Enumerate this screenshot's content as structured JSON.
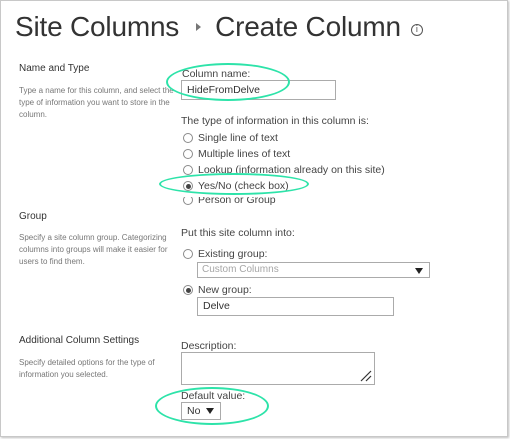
{
  "header": {
    "breadcrumb_parent": "Site Columns",
    "page_title": "Create Column"
  },
  "name_type": {
    "heading": "Name and Type",
    "description": "Type a name for this column, and select the type of information you want to store in the column.",
    "column_name_label": "Column name:",
    "column_name_value": "HideFromDelve",
    "type_label": "The type of information in this column is:",
    "types": [
      {
        "label": "Single line of text",
        "selected": false
      },
      {
        "label": "Multiple lines of text",
        "selected": false
      },
      {
        "label": "Lookup (information already on this site)",
        "selected": false
      },
      {
        "label": "Yes/No (check box)",
        "selected": true
      },
      {
        "label": "Person or Group",
        "selected": false
      }
    ]
  },
  "group": {
    "heading": "Group",
    "description": "Specify a site column group. Categorizing columns into groups will make it easier for users to find them.",
    "put_label": "Put this site column into:",
    "existing_label": "Existing group:",
    "existing_selected": false,
    "existing_value": "Custom Columns",
    "new_label": "New group:",
    "new_selected": true,
    "new_value": "Delve"
  },
  "additional": {
    "heading": "Additional Column Settings",
    "description": "Specify detailed options for the type of information you selected.",
    "description_label": "Description:",
    "description_value": "",
    "default_label": "Default value:",
    "default_value": "No"
  },
  "colors": {
    "highlight": "#2de3a9",
    "text": "#444444",
    "border": "#ababab"
  }
}
